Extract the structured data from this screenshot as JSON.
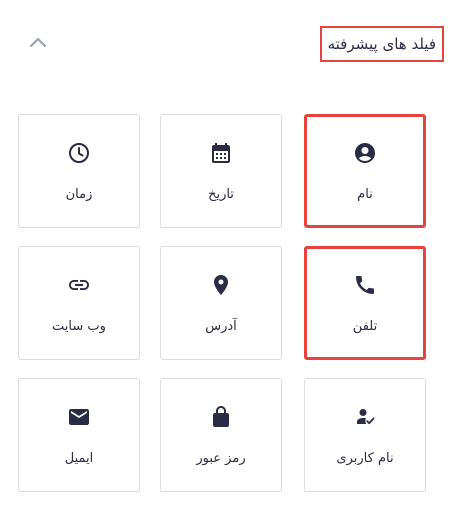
{
  "section": {
    "title": "فیلد های پیشرفته",
    "collapse_icon": "chevron-up-icon"
  },
  "fields": [
    {
      "label": "نام",
      "icon": "account-circle-icon",
      "highlighted": true
    },
    {
      "label": "تاریخ",
      "icon": "calendar-icon",
      "highlighted": false
    },
    {
      "label": "زمان",
      "icon": "clock-icon",
      "highlighted": false
    },
    {
      "label": "تلفن",
      "icon": "phone-icon",
      "highlighted": true
    },
    {
      "label": "آدرس",
      "icon": "location-pin-icon",
      "highlighted": false
    },
    {
      "label": "وب سایت",
      "icon": "link-icon",
      "highlighted": false
    },
    {
      "label": "نام کاربری",
      "icon": "user-check-icon",
      "highlighted": false
    },
    {
      "label": "رمز عبور",
      "icon": "lock-icon",
      "highlighted": false
    },
    {
      "label": "ایمیل",
      "icon": "mail-icon",
      "highlighted": false
    }
  ],
  "colors": {
    "text": "#2a2b45",
    "icon": "#2a2b45",
    "chevron": "#9ea0b8",
    "border": "#dadbe3",
    "highlight": "#e8423f"
  }
}
